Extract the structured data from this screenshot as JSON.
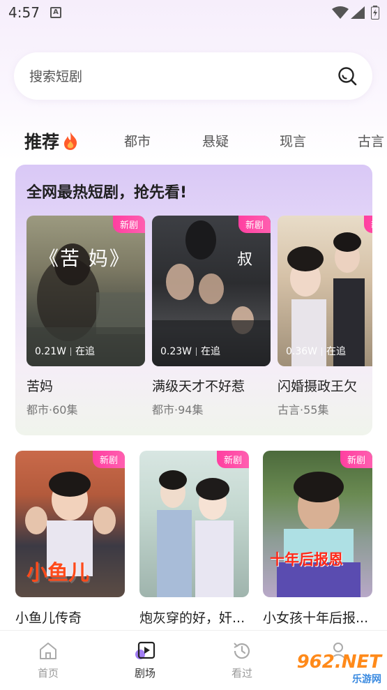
{
  "status": {
    "time": "4:57"
  },
  "search": {
    "placeholder": "搜索短剧"
  },
  "tabs": [
    {
      "label": "推荐"
    },
    {
      "label": "都市"
    },
    {
      "label": "悬疑"
    },
    {
      "label": "现言"
    },
    {
      "label": "古言"
    }
  ],
  "featured": {
    "title": "全网最热短剧，抢先看!",
    "items": [
      {
        "badge": "新剧",
        "poster_text": "《苦 妈》",
        "views": "0.21W",
        "follow": "在追",
        "name": "苦妈",
        "meta": "都市·60集"
      },
      {
        "badge": "新剧",
        "poster_text": "",
        "views": "0.23W",
        "follow": "在追",
        "name": "满级天才不好惹",
        "meta": "都市·94集"
      },
      {
        "badge": "新剧",
        "poster_text": "",
        "views": "0.36W",
        "follow": "在追",
        "name": "闪婚摄政王欠",
        "meta": "古言·55集"
      }
    ]
  },
  "grid": [
    {
      "badge": "新剧",
      "poster_text": "小鱼儿",
      "name": "小鱼儿传奇"
    },
    {
      "badge": "新剧",
      "poster_text": "",
      "name": "炮灰穿的好，奸..."
    },
    {
      "badge": "新剧",
      "poster_text": "十年后报恩",
      "name": "小女孩十年后报..."
    }
  ],
  "bottom_nav": [
    {
      "label": "首页",
      "icon": "home-icon"
    },
    {
      "label": "剧场",
      "icon": "theater-icon"
    },
    {
      "label": "看过",
      "icon": "history-icon"
    },
    {
      "label": "",
      "icon": "profile-icon"
    }
  ],
  "watermark": {
    "text": "962.NET",
    "sub": "乐游网"
  },
  "colors": {
    "badge": "#ff4aa6",
    "accent": "#8a5cf0",
    "fire": "#ff5a2a"
  }
}
